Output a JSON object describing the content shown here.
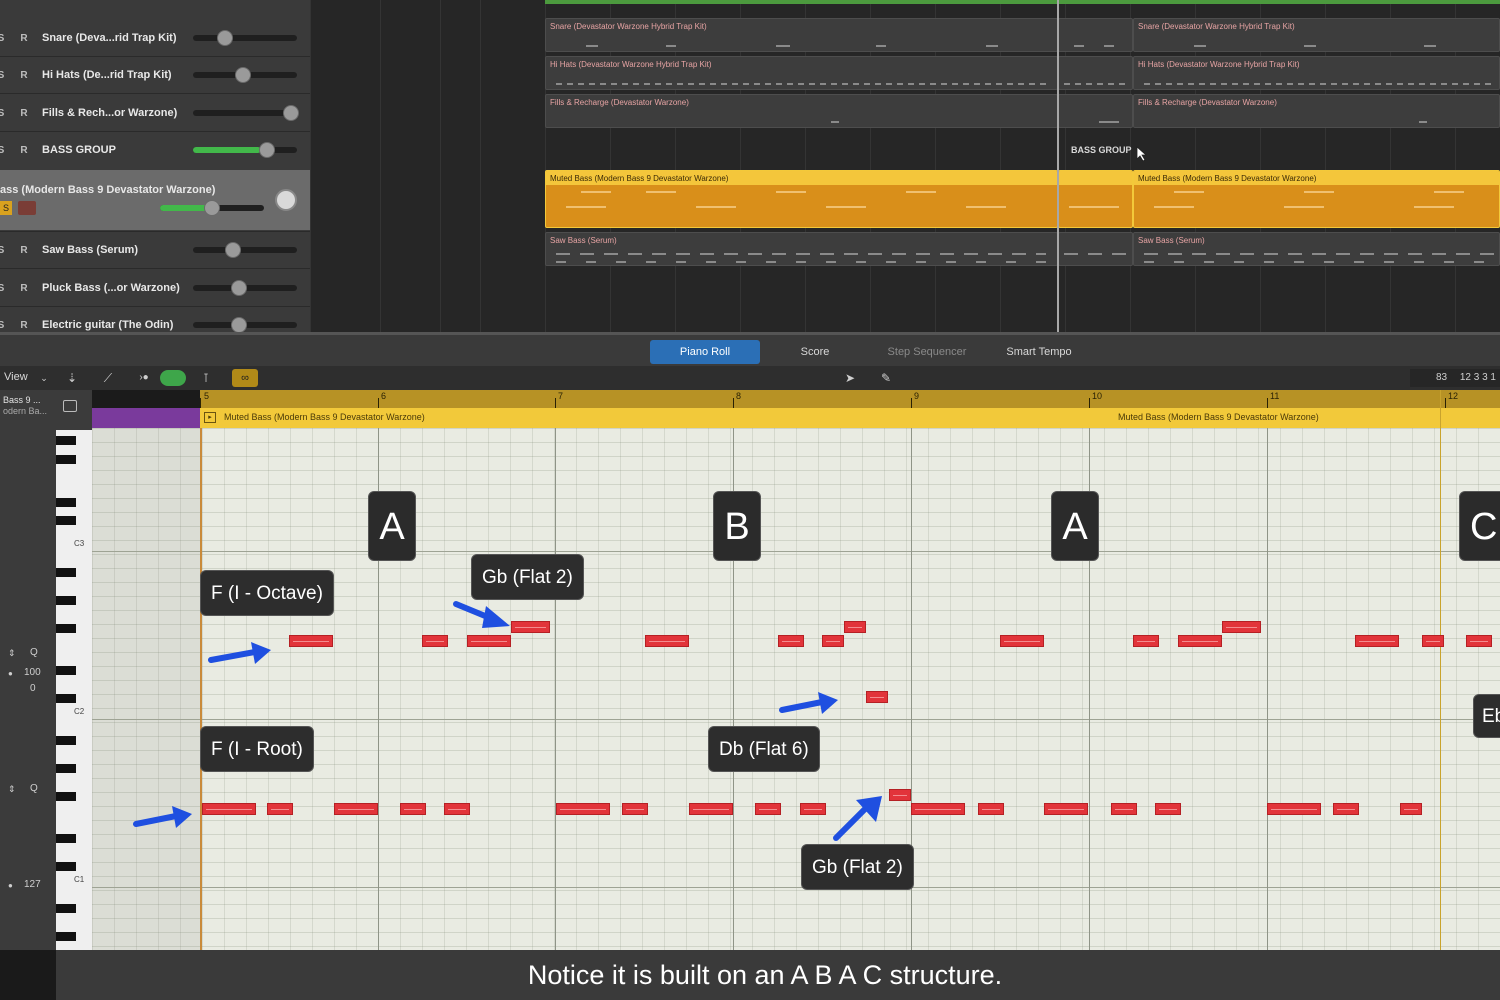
{
  "tracks": [
    {
      "solo": "S",
      "record": "R",
      "name": "Snare (Deva...rid Trap Kit)"
    },
    {
      "solo": "S",
      "record": "R",
      "name": "Hi Hats (De...rid Trap Kit)"
    },
    {
      "solo": "S",
      "record": "R",
      "name": "Fills & Rech...or Warzone)"
    },
    {
      "solo": "S",
      "record": "R",
      "name": "BASS GROUP"
    },
    {
      "solo": "S",
      "record": "",
      "name": "ass (Modern Bass 9 Devastator Warzone)"
    },
    {
      "solo": "S",
      "record": "R",
      "name": "Saw Bass (Serum)"
    },
    {
      "solo": "S",
      "record": "R",
      "name": "Pluck Bass (...or Warzone)"
    },
    {
      "solo": "S",
      "record": "R",
      "name": "Electric guitar (The Odin)"
    }
  ],
  "arrange_regions": {
    "snare": "Snare (Devastator Warzone Hybrid Trap Kit)",
    "hihats": "Hi Hats (Devastator Warzone Hybrid Trap Kit)",
    "fills": "Fills & Recharge (Devastator Warzone)",
    "bass_group": "BASS GROUP",
    "muted_bass": "Muted Bass (Modern Bass 9 Devastator Warzone)",
    "saw_bass": "Saw Bass (Serum)"
  },
  "editor_tabs": [
    {
      "label": "Piano Roll",
      "active": true
    },
    {
      "label": "Score",
      "active": false
    },
    {
      "label": "Step Sequencer",
      "active": false
    },
    {
      "label": "Smart Tempo",
      "active": false
    }
  ],
  "toolbar": {
    "view_label": "View",
    "counter_a": "83",
    "counter_b": "12 3 3 1"
  },
  "inspector": {
    "instrument_line1": "Bass 9 ...",
    "instrument_line2": "odern Ba...",
    "q_label": "Q",
    "value_100": "100",
    "value_0": "0",
    "q_label_2": "Q",
    "value_127": "127"
  },
  "octave_labels": [
    "C3",
    "C2",
    "C1"
  ],
  "ruler_bars": [
    "5",
    "6",
    "7",
    "8",
    "9",
    "10",
    "11",
    "12"
  ],
  "region_strip": {
    "left_label": "Muted Bass (Modern Bass 9 Devastator Warzone)",
    "right_label": "Muted Bass (Modern Bass 9 Devastator Warzone)"
  },
  "sections": [
    "A",
    "B",
    "A",
    "C"
  ],
  "callouts": {
    "f_octave": "F (I - Octave)",
    "gb_flat2_top": "Gb (Flat 2)",
    "f_root": "F (I - Root)",
    "db_flat6": "Db (Flat 6)",
    "gb_flat2_bottom": "Gb (Flat 2)",
    "eb_partial": "Eb"
  },
  "subtitle": "Notice it is built on an A B A C structure.",
  "colors": {
    "note": "#e2343a",
    "region_yellow": "#f2c93a",
    "active_tab": "#2b6fb6",
    "arrow_blue": "#1f4fe0",
    "fader_green": "#42b84a"
  }
}
